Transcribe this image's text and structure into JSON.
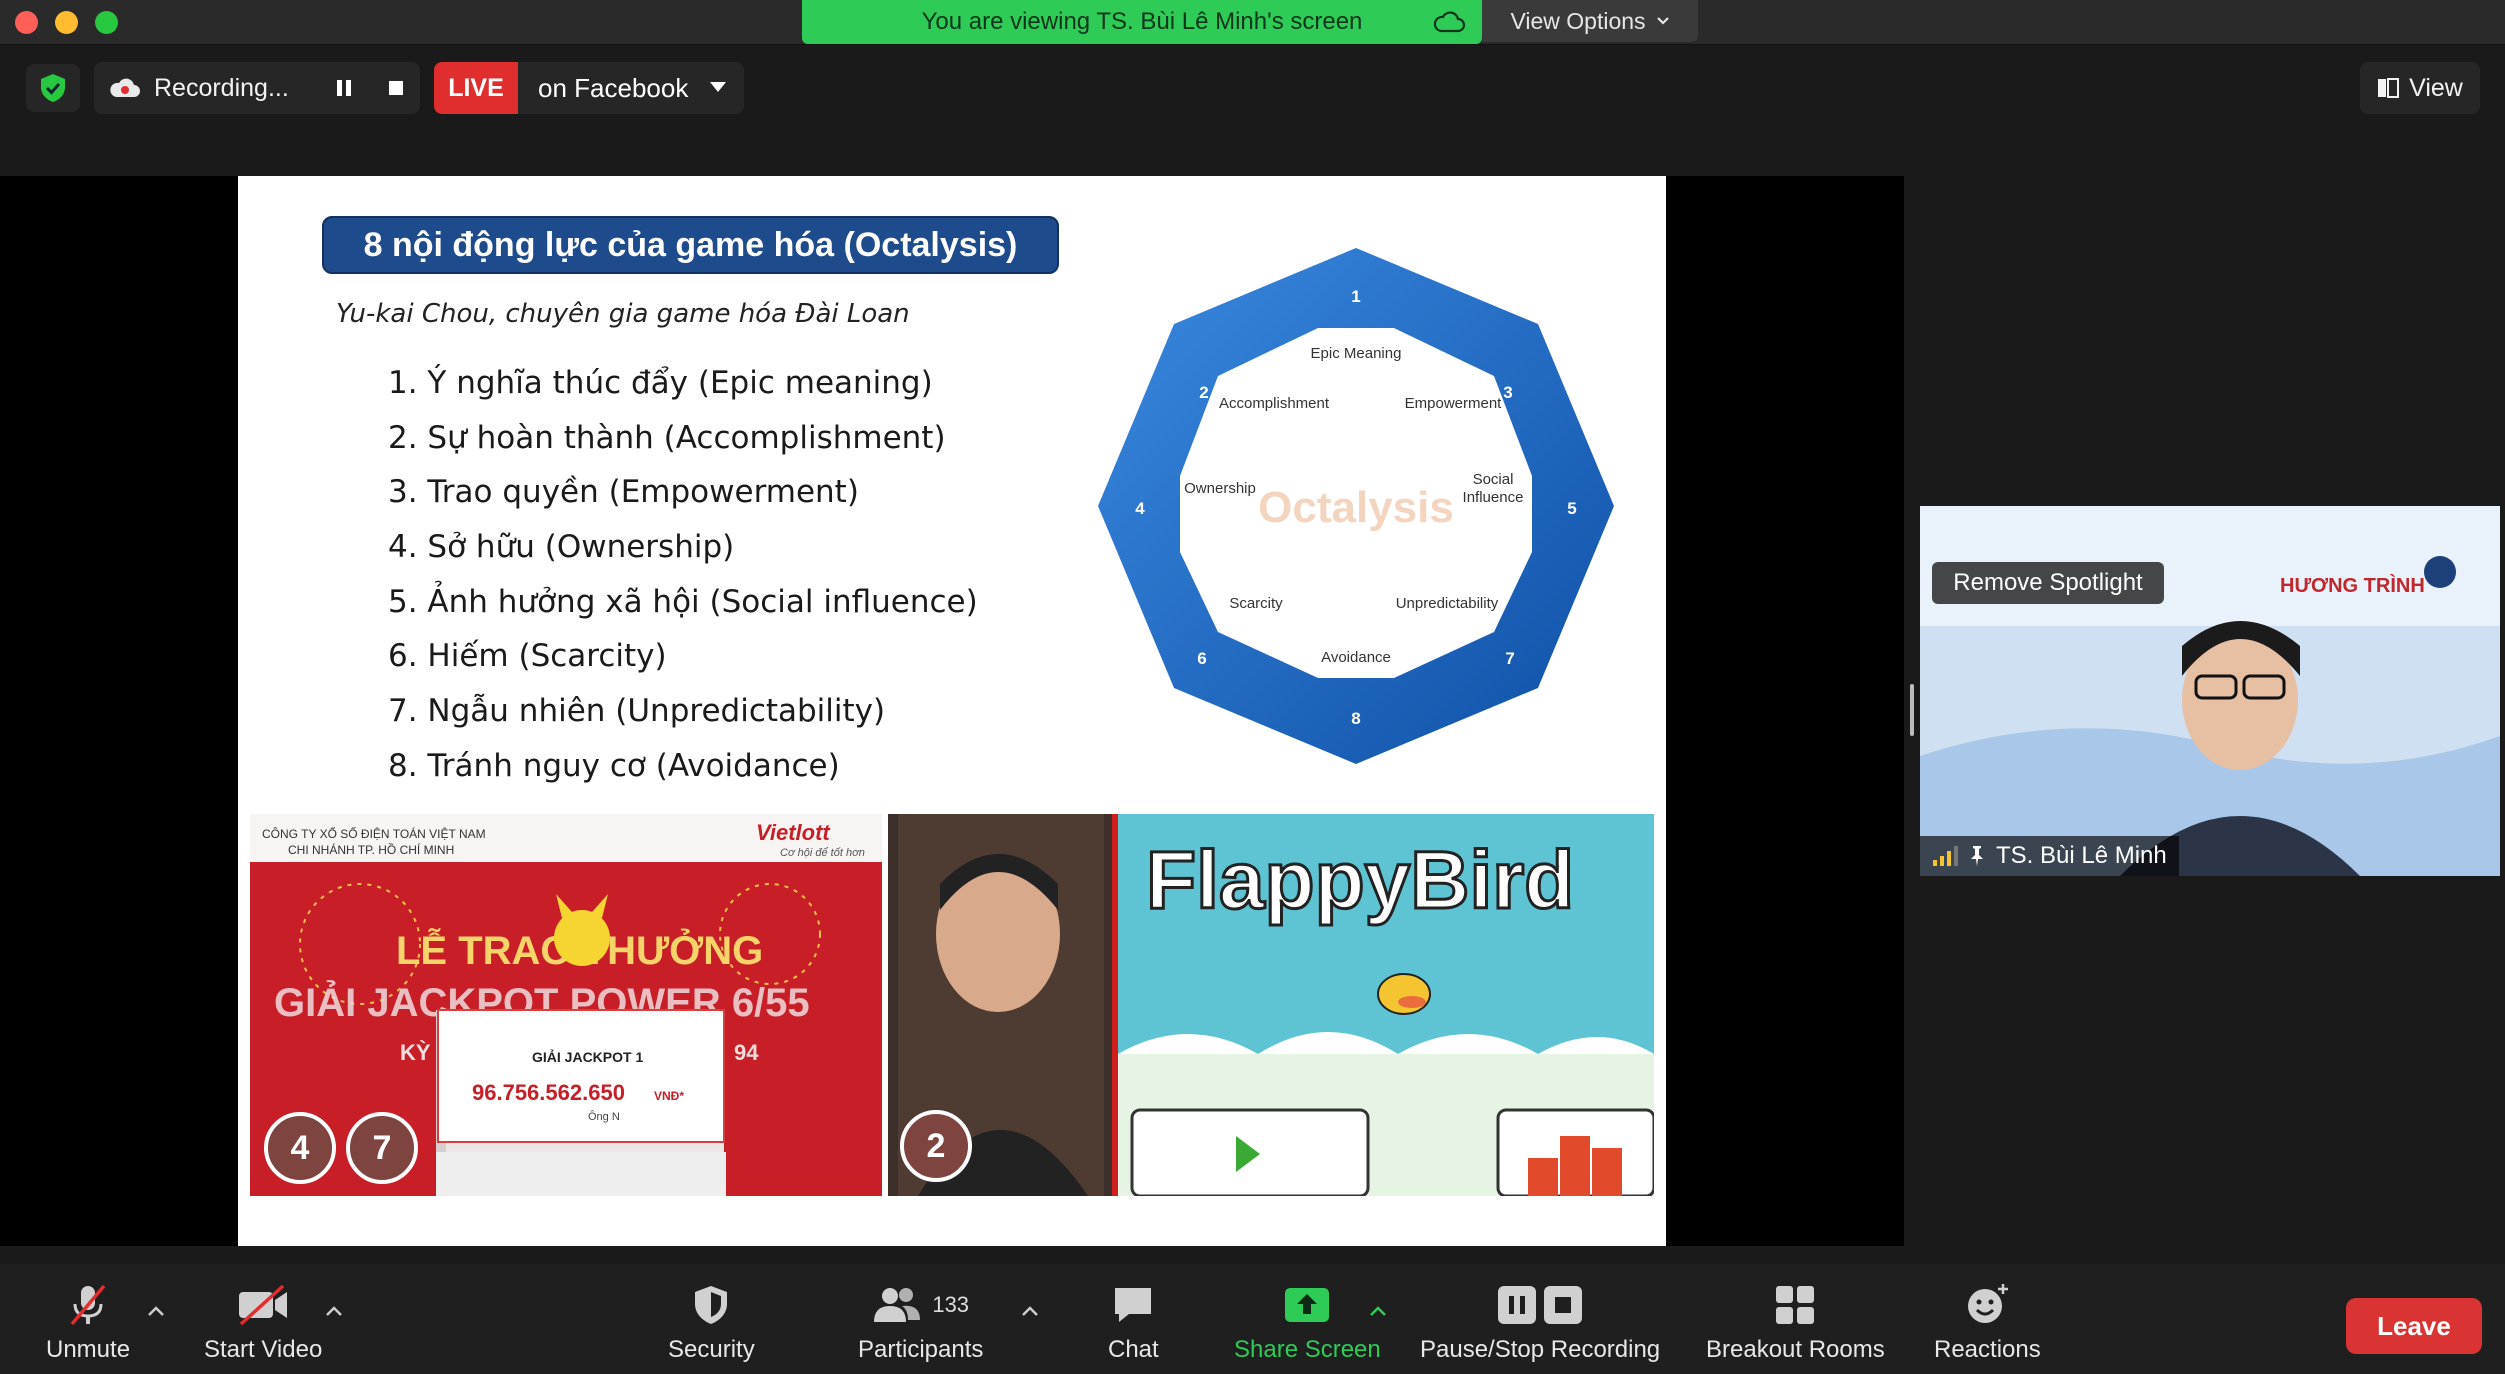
{
  "window": {
    "share_banner": "You are viewing TS. Bùi Lê Minh's screen",
    "view_options": "View Options"
  },
  "recording": {
    "status": "Recording...",
    "live_badge": "LIVE",
    "live_target": "on Facebook",
    "view_label": "View"
  },
  "slide": {
    "title": "8 nội động lực của game hóa (Octalysis)",
    "subtitle": "Yu-kai Chou, chuyên gia game hóa Đài Loan",
    "motivators": [
      "1. Ý nghĩa thúc đẩy (Epic meaning)",
      "2. Sự hoàn thành (Accomplishment)",
      "3. Trao quyền (Empowerment)",
      "4. Sở hữu (Ownership)",
      "5. Ảnh hưởng xã hội (Social influence)",
      "6. Hiếm (Scarcity)",
      "7. Ngẫu nhiên (Unpredictability)",
      "8. Tránh nguy cơ (Avoidance)"
    ],
    "octalysis": {
      "center_text": "Octalysis",
      "drives": [
        "Epic Meaning",
        "Empowerment",
        "Social",
        "Influence",
        "Unpredictability",
        "Avoidance",
        "Scarcity",
        "Ownership",
        "Accomplishment"
      ],
      "numbers": [
        "1",
        "2",
        "3",
        "4",
        "5",
        "6",
        "7",
        "8"
      ]
    },
    "lottery_photo": {
      "company": "CÔNG TY XỔ SỐ ĐIỆN TOÁN VIỆT NAM",
      "branch": "CHI NHÁNH TP. HỒ CHÍ MINH",
      "brand": "Vietlott",
      "brand_tagline": "Cơ hội để tốt hơn",
      "ceremony": "LỄ TRAO THƯỞNG",
      "prize_line": "GIẢI JACKPOT POWER 6/55",
      "ky": "KỲ",
      "ky_number": "94",
      "check_title": "GIẢI JACKPOT 1",
      "check_amount": "96.756.562.650",
      "check_currency": "VNĐ*",
      "check_payee": "Ông N",
      "badges": [
        "4",
        "7"
      ]
    },
    "flappy_photo": {
      "game_title": "FlappyBird",
      "badges": [
        "2"
      ]
    }
  },
  "participant": {
    "spotlight_label": "Remove Spotlight",
    "name": "TS. Bùi Lê Minh",
    "banner_text": "HƯƠNG TRÌNH"
  },
  "toolbar": {
    "unmute": "Unmute",
    "start_video": "Start Video",
    "security": "Security",
    "participants": "Participants",
    "participant_count": "133",
    "chat": "Chat",
    "share_screen": "Share Screen",
    "pause_stop": "Pause/Stop Recording",
    "breakout": "Breakout Rooms",
    "reactions": "Reactions",
    "leave": "Leave"
  },
  "colors": {
    "share_green": "#2ecc56",
    "live_red": "#e02d2d",
    "leave_red": "#d93433",
    "slide_title_blue": "#1e4b8c",
    "octa_blue": "#1f6fd0"
  }
}
